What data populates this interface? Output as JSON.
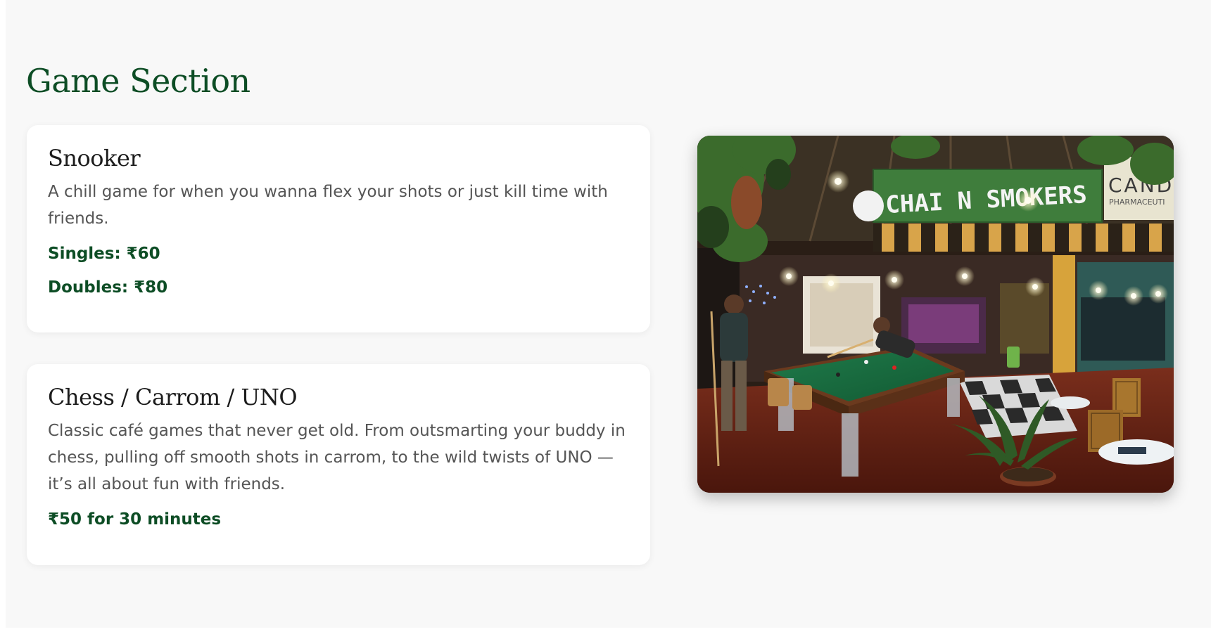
{
  "section": {
    "title": "Game Section"
  },
  "games": [
    {
      "title": "Snooker",
      "description": "A chill game for when you wanna flex your shots or just kill time with friends.",
      "prices": [
        "Singles: ₹60",
        "Doubles: ₹80"
      ]
    },
    {
      "title": "Chess / Carrom / UNO",
      "description": "Classic café games that never get old. From outsmarting your buddy in chess, pulling off smooth shots in carrom, to the wild twists of UNO — it’s all about fun with friends.",
      "prices": [
        "₹50 for 30 minutes"
      ]
    }
  ],
  "photo": {
    "sign_text": "CHAI N SMOKERS",
    "shop_sign_text": "CAND",
    "shop_sub_text": "PHARMACEUTI"
  },
  "colors": {
    "accent_green": "#0d4d25",
    "page_bg": "#f8f8f8",
    "card_bg": "#ffffff",
    "body_text": "#555555"
  }
}
